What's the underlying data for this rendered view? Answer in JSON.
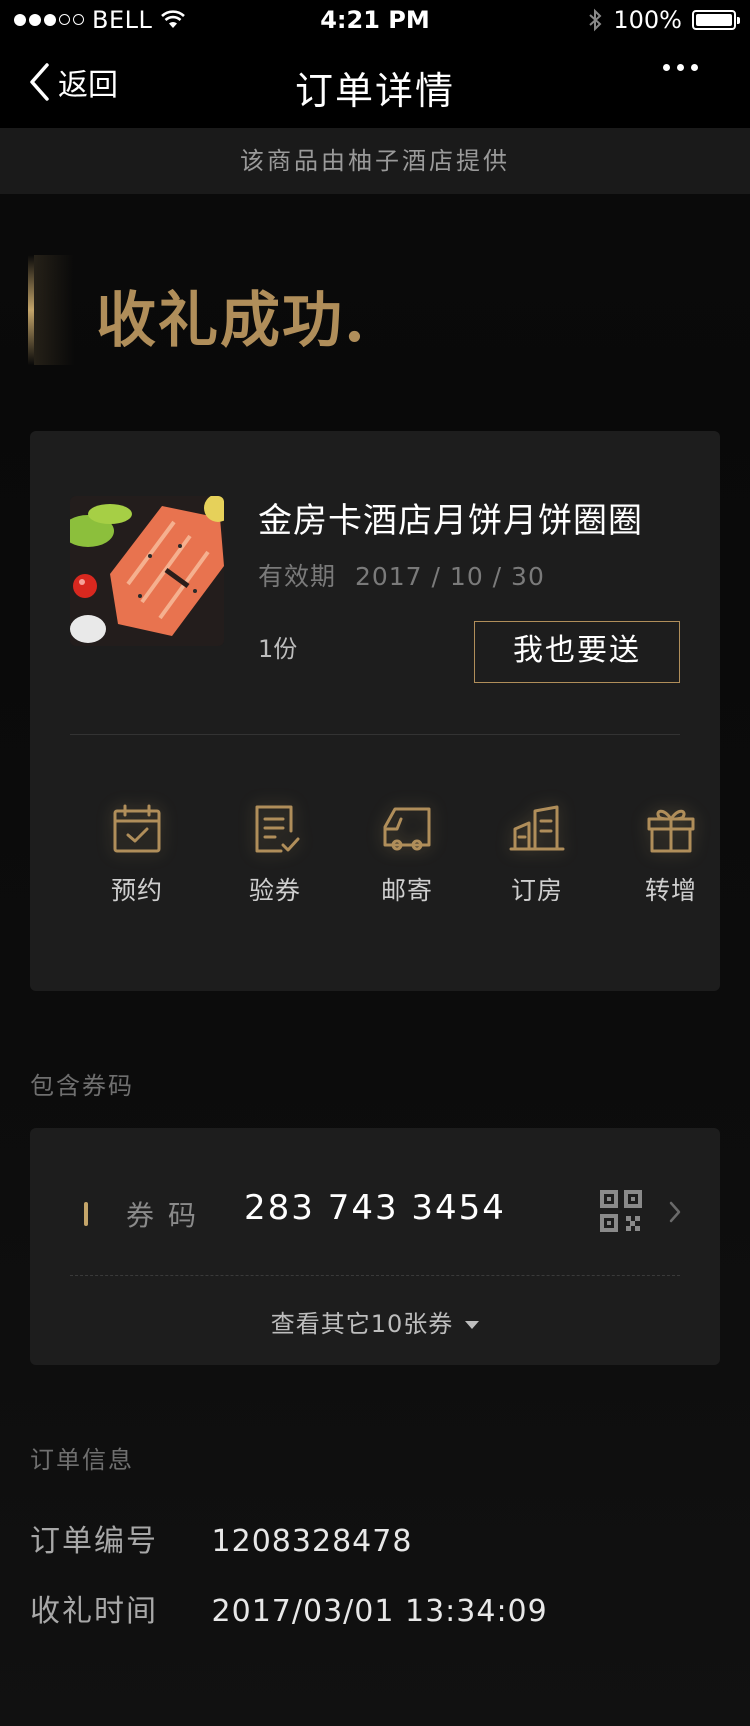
{
  "status_bar": {
    "carrier": "BELL",
    "time": "4:21 PM",
    "battery": "100%"
  },
  "nav": {
    "back_label": "返回",
    "title": "订单详情"
  },
  "provider_notice": "该商品由柚子酒店提供",
  "hero": {
    "title": "收礼成功."
  },
  "product": {
    "name": "金房卡酒店月饼月饼圈圈",
    "validity_label": "有效期",
    "validity_date": "2017 / 10 / 30",
    "quantity": "1份",
    "give_button": "我也要送"
  },
  "actions": [
    {
      "label": "预约",
      "icon": "calendar-check-icon"
    },
    {
      "label": "验券",
      "icon": "document-check-icon"
    },
    {
      "label": "邮寄",
      "icon": "truck-icon"
    },
    {
      "label": "订房",
      "icon": "building-icon"
    },
    {
      "label": "转增",
      "icon": "gift-icon"
    }
  ],
  "coupons": {
    "section_label": "包含券码",
    "code_label": "券码",
    "code": "283 743 3454",
    "view_others": "查看其它10张券"
  },
  "order_info": {
    "section_label": "订单信息",
    "rows": [
      {
        "key": "订单编号",
        "value": "1208328478"
      },
      {
        "key": "收礼时间",
        "value": "2017/03/01 13:34:09"
      }
    ]
  },
  "colors": {
    "accent_gold": "#b08e5a",
    "card_bg": "#1d1d1d",
    "page_bg": "#0b0b0b"
  }
}
